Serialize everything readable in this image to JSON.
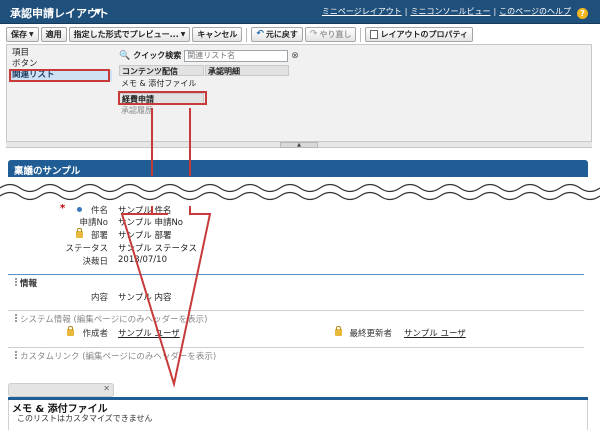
{
  "header": {
    "title": "承認申請レイアウト",
    "links": [
      "ミニページレイアウト",
      "ミニコンソールビュー",
      "このページのヘルプ"
    ],
    "help_icon_glyph": "?"
  },
  "toolbar": {
    "save_label": "保存",
    "save_caret": "▼",
    "apply_label": "適用",
    "preview_label": "指定した形式でプレビュー...",
    "preview_caret": "▼",
    "cancel_label": "キャンセル",
    "undo_label": "元に戻す",
    "redo_label": "やり直し",
    "properties_label": "レイアウトのプロパティ"
  },
  "palette": {
    "categories": [
      "項目",
      "ボタン",
      "関連リスト"
    ],
    "selected_category": "関連リスト",
    "quick_search_label": "クイック検索",
    "quick_search_placeholder": "関連リスト名",
    "tiles": {
      "content_dist": "コンテンツ配信",
      "approval_detail": "承認明細",
      "notes_attachments": "メモ & 添付ファイル",
      "expense": "経費申請",
      "approval_history": "承認履歴"
    }
  },
  "section": {
    "title": "稟議のサンプル"
  },
  "fields": [
    {
      "label": "件名",
      "value": "サンプル 件名"
    },
    {
      "label": "申請No",
      "value": "サンプル 申請No"
    },
    {
      "label": "部署",
      "value": "サンプル 部署"
    },
    {
      "label": "ステータス",
      "value": "サンプル ステータス"
    },
    {
      "label": "決裁日",
      "value": "2013/07/10"
    }
  ],
  "info_section": {
    "title": "情報",
    "field_label": "内容",
    "field_value": "サンプル 内容"
  },
  "system_section": {
    "title": "システム情報 (編集ページにのみヘッダーを表示)",
    "created_by_label": "作成者",
    "created_by_value": "サンプル ユーザ",
    "modified_by_label": "最終更新者",
    "modified_by_value": "サンプル ユーザ"
  },
  "custom_links": {
    "title": "カスタムリンク (編集ページにのみヘッダーを表示)"
  },
  "related_list": {
    "title": "メモ & 添付ファイル",
    "note": "このリストはカスタマイズできません",
    "close_glyph": "✕"
  },
  "colors": {
    "header_bg": "#1f4f7b",
    "section_bg": "#1f5d94",
    "highlight": "#c83a3a",
    "required": "#c00000"
  }
}
